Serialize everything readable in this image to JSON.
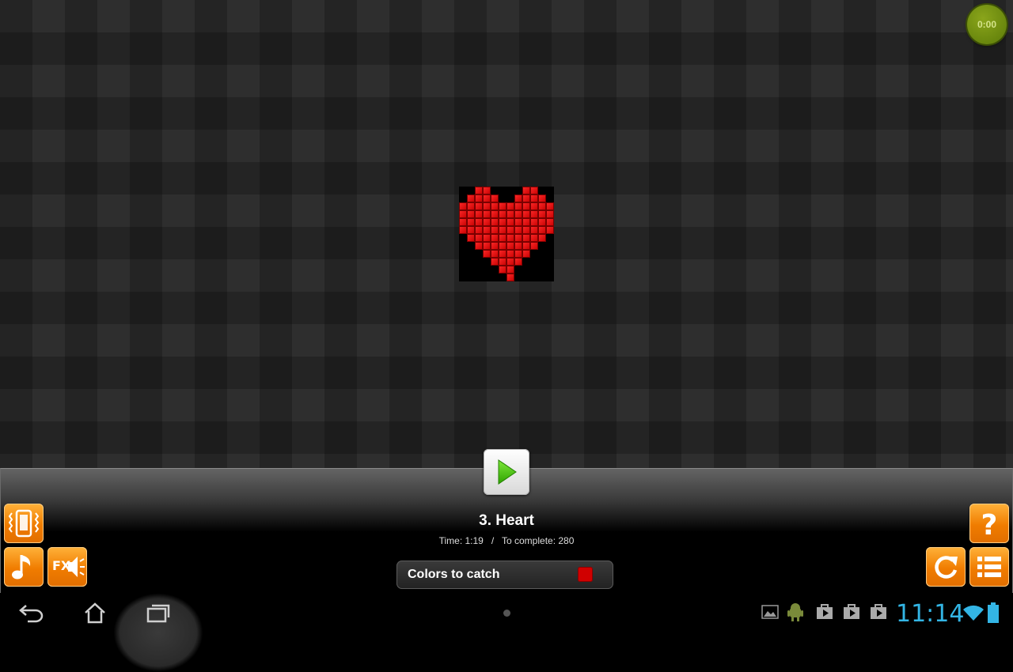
{
  "game": {
    "timer": "0:00",
    "level_title": "3. Heart",
    "time_label": "Time: 1:19",
    "separator": "/",
    "complete_label": "To complete: 280",
    "colors_to_catch_label": "Colors to catch",
    "catch_color": "#d00000",
    "puzzle_rows": [
      "..##....##..",
      ".####..####.",
      "############",
      "############",
      "############",
      "############",
      ".##########.",
      "..########..",
      "...######...",
      "....####....",
      ".....##.....",
      "......#....."
    ]
  },
  "buttons": {
    "vibrate": "vibrate-icon",
    "music": "music-note-icon",
    "fx_label": "FX",
    "help": "question-mark-icon",
    "restart": "restart-icon",
    "menu": "list-icon",
    "play": "play-icon"
  },
  "status_bar": {
    "clock": "11:14",
    "accent_color": "#33b5e5"
  }
}
